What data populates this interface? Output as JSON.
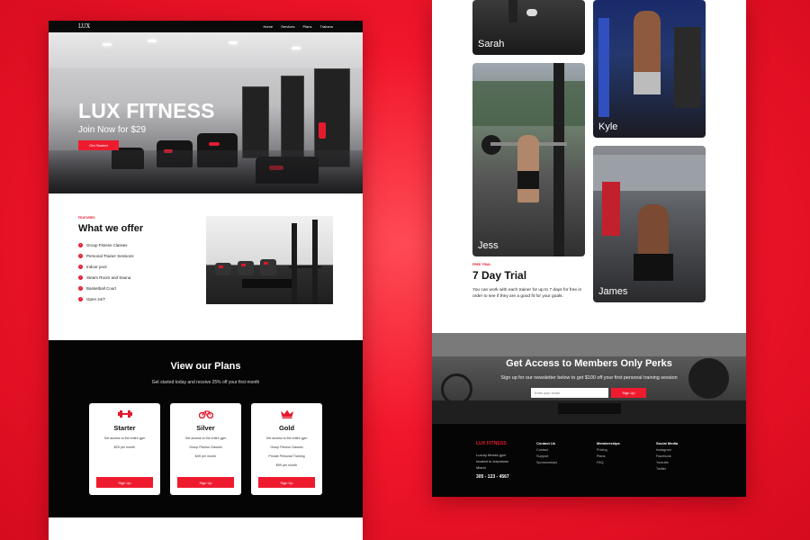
{
  "left": {
    "nav": {
      "logo": "LUX",
      "links": [
        "Home",
        "Services",
        "Plans",
        "Trainers"
      ]
    },
    "hero": {
      "title": "LUX FITNESS",
      "subtitle": "Join Now for $29",
      "cta": "Get Started"
    },
    "features": {
      "tag": "FEATURES",
      "title": "What we offer",
      "items": [
        "Group Fitness Classes",
        "Personal Trainer Sessions",
        "Indoor pool",
        "Steam Room and Sauna",
        "Basketball Court",
        "Open 24/7"
      ]
    },
    "plans": {
      "title": "View our Plans",
      "subtitle": "Get started today and receive 25% off your first month",
      "cards": [
        {
          "icon": "dumbbell-icon",
          "name": "Starter",
          "features": [
            "Get access to the entire gym",
            "$25 per month"
          ],
          "button": "Sign Up"
        },
        {
          "icon": "bicycle-icon",
          "name": "Silver",
          "features": [
            "Get access to the entire gym",
            "Group Fitness Classes",
            "$49 per month"
          ],
          "button": "Sign Up"
        },
        {
          "icon": "crown-icon",
          "name": "Gold",
          "features": [
            "Get access to the entire gym",
            "Group Fitness Classes",
            "Private Personal Training",
            "$99 per month"
          ],
          "button": "Sign Up"
        }
      ]
    }
  },
  "right": {
    "trainers": [
      "Sarah",
      "Kyle",
      "Jess",
      "James"
    ],
    "trial": {
      "tag": "FREE TRIAL",
      "title": "7 Day Trial",
      "body": "You can work with each trainer for up to 7 days for free in order to see if they are a good fit for your goals."
    },
    "perks": {
      "title": "Get Access to Members Only Perks",
      "subtitle": "Sign up for our newsletter below to get $100 off your first personal training session",
      "placeholder": "Enter your email",
      "button": "Sign Up"
    },
    "footer": {
      "brand": "LUX FITNESS",
      "address": [
        "Luxury fitness gym",
        "located in downtown",
        "Miami"
      ],
      "phone": "305 - 123 - 4567",
      "columns": [
        {
          "heading": "Contact Us",
          "links": [
            "Contact",
            "Support",
            "Sponsorships"
          ]
        },
        {
          "heading": "Memberships",
          "links": [
            "Pricing",
            "Plans",
            "FAQ"
          ]
        },
        {
          "heading": "Social Media",
          "links": [
            "Instagram",
            "Facebook",
            "Youtube",
            "Twitter"
          ]
        }
      ]
    }
  },
  "colors": {
    "accent": "#ee1b2f",
    "background": "#f1162b",
    "dark": "#050505"
  }
}
